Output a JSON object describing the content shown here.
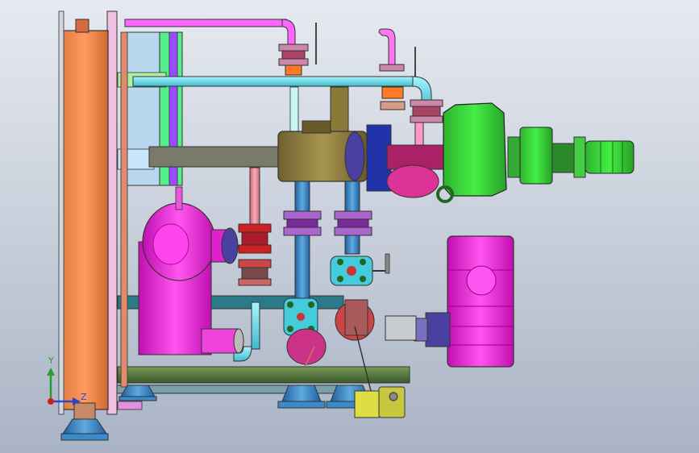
{
  "view": {
    "background_top": "#e6eaf0",
    "background_bottom": "#a9b3c4"
  },
  "triad": {
    "y_label": "Y",
    "z_label": "Z",
    "y_color": "#2a9a2a",
    "z_color": "#2a48c8",
    "origin_color": "#d02020"
  },
  "components": [
    {
      "name": "heat-exchanger-plate",
      "color": "#f08a50"
    },
    {
      "name": "steam-pipe",
      "color": "#ff66ff"
    },
    {
      "name": "water-pipe",
      "color": "#66ddee"
    },
    {
      "name": "frame",
      "color": "#4a6a3a"
    },
    {
      "name": "support-bracket",
      "color": "#c9e6ff"
    },
    {
      "name": "pump-motor",
      "color": "#22dd22"
    },
    {
      "name": "tank-cylinder",
      "color": "#8b7a3a"
    },
    {
      "name": "pump-casing",
      "color": "#ff33dd"
    },
    {
      "name": "valve-body",
      "color": "#44ccdd"
    },
    {
      "name": "flange",
      "color": "#cc2222"
    },
    {
      "name": "base-foot",
      "color": "#3a8acc"
    },
    {
      "name": "sensor",
      "color": "#dddd44"
    }
  ]
}
